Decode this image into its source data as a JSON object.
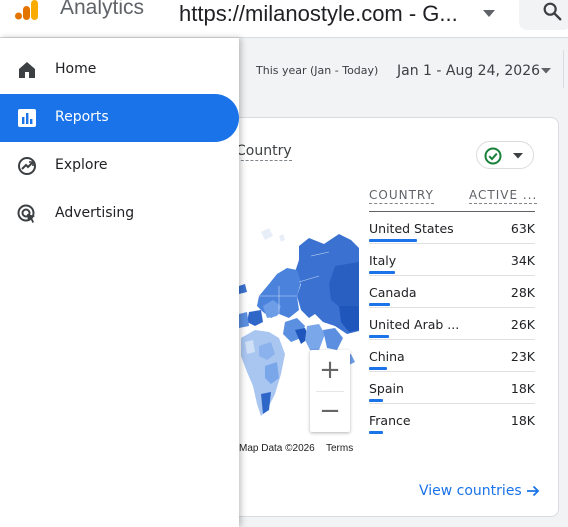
{
  "header": {
    "app_title": "Analytics",
    "property": "https://milanostyle.com - G...",
    "logo_icon": "analytics-logo",
    "search_icon": "search-icon"
  },
  "sidebar": {
    "items": [
      {
        "label": "Home",
        "icon": "home-icon",
        "active": false
      },
      {
        "label": "Reports",
        "icon": "reports-icon",
        "active": true
      },
      {
        "label": "Explore",
        "icon": "explore-icon",
        "active": false
      },
      {
        "label": "Advertising",
        "icon": "advertising-icon",
        "active": false
      }
    ]
  },
  "date_range": {
    "label": "This year (Jan - Today)",
    "value": "Jan 1 - Aug 24, 2026"
  },
  "card": {
    "title": "Country",
    "columns": [
      "COUNTRY",
      "ACTIVE ..."
    ],
    "rows": [
      {
        "country": "United States",
        "value": "63K",
        "fraction": 1.0
      },
      {
        "country": "Italy",
        "value": "34K",
        "fraction": 0.54
      },
      {
        "country": "Canada",
        "value": "28K",
        "fraction": 0.44
      },
      {
        "country": "United Arab ...",
        "value": "26K",
        "fraction": 0.41
      },
      {
        "country": "China",
        "value": "23K",
        "fraction": 0.37
      },
      {
        "country": "Spain",
        "value": "18K",
        "fraction": 0.29
      },
      {
        "country": "France",
        "value": "18K",
        "fraction": 0.29
      }
    ],
    "map_attribution": "Map Data ©2026",
    "map_terms": "Terms",
    "zoom_in": "+",
    "zoom_out": "−",
    "view_link": "View countries"
  },
  "colors": {
    "accent": "#1a73e8",
    "status_ok": "#188038"
  }
}
